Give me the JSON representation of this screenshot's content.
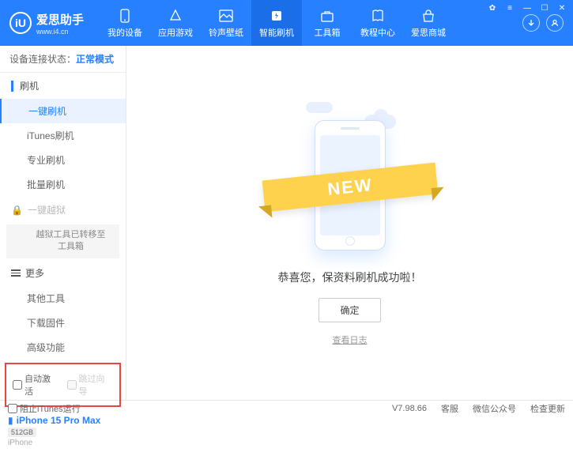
{
  "header": {
    "logo_badge": "iU",
    "title": "爱思助手",
    "subtitle": "www.i4.cn",
    "nav": [
      {
        "label": "我的设备"
      },
      {
        "label": "应用游戏"
      },
      {
        "label": "铃声壁纸"
      },
      {
        "label": "智能刷机"
      },
      {
        "label": "工具箱"
      },
      {
        "label": "教程中心"
      },
      {
        "label": "爱思商城"
      }
    ]
  },
  "sidebar": {
    "status_label": "设备连接状态：",
    "status_mode": "正常模式",
    "section_flash": "刷机",
    "items_flash": [
      "一键刷机",
      "iTunes刷机",
      "专业刷机",
      "批量刷机"
    ],
    "section_jailbreak": "一键越狱",
    "jailbreak_notice": "越狱工具已转移至工具箱",
    "section_more": "更多",
    "items_more": [
      "其他工具",
      "下载固件",
      "高级功能"
    ],
    "chk_auto_activate": "自动激活",
    "chk_skip_guide": "跳过向导",
    "device_name": "iPhone 15 Pro Max",
    "device_storage": "512GB",
    "device_type": "iPhone"
  },
  "main": {
    "banner_text": "NEW",
    "success_msg": "恭喜您，保资料刷机成功啦！",
    "ok_label": "确定",
    "log_link": "查看日志"
  },
  "footer": {
    "block_itunes": "阻止iTunes运行",
    "version": "V7.98.66",
    "links": [
      "客服",
      "微信公众号",
      "检查更新"
    ]
  }
}
